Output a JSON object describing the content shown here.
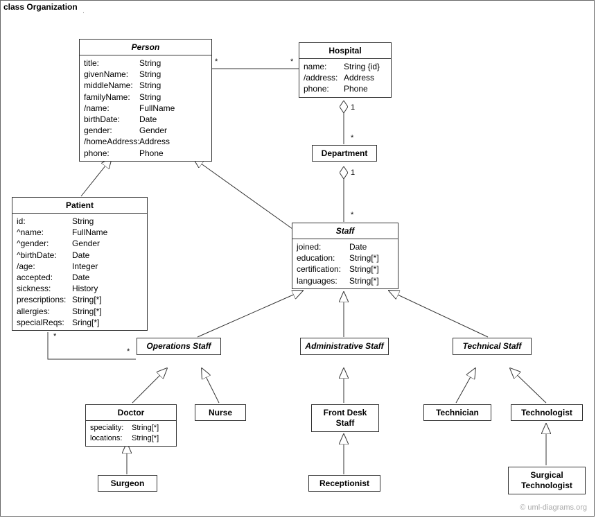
{
  "frame": {
    "title": "class Organization"
  },
  "watermark": "© uml-diagrams.org",
  "classes": {
    "person": {
      "title": "Person",
      "attrs": [
        {
          "name": "title:",
          "type": "String"
        },
        {
          "name": "givenName:",
          "type": "String"
        },
        {
          "name": "middleName:",
          "type": "String"
        },
        {
          "name": "familyName:",
          "type": "String"
        },
        {
          "name": "/name:",
          "type": "FullName"
        },
        {
          "name": "birthDate:",
          "type": "Date"
        },
        {
          "name": "gender:",
          "type": "Gender"
        },
        {
          "name": "/homeAddress:",
          "type": "Address"
        },
        {
          "name": "phone:",
          "type": "Phone"
        }
      ]
    },
    "hospital": {
      "title": "Hospital",
      "attrs": [
        {
          "name": "name:",
          "type": "String {id}"
        },
        {
          "name": "/address:",
          "type": "Address"
        },
        {
          "name": "phone:",
          "type": "Phone"
        }
      ]
    },
    "department": {
      "title": "Department"
    },
    "patient": {
      "title": "Patient",
      "attrs": [
        {
          "name": "id:",
          "type": "String"
        },
        {
          "name": "^name:",
          "type": "FullName"
        },
        {
          "name": "^gender:",
          "type": "Gender"
        },
        {
          "name": "^birthDate:",
          "type": "Date"
        },
        {
          "name": "/age:",
          "type": "Integer"
        },
        {
          "name": "accepted:",
          "type": "Date"
        },
        {
          "name": "sickness:",
          "type": "History"
        },
        {
          "name": "prescriptions:",
          "type": "String[*]"
        },
        {
          "name": "allergies:",
          "type": "String[*]"
        },
        {
          "name": "specialReqs:",
          "type": "Sring[*]"
        }
      ]
    },
    "staff": {
      "title": "Staff",
      "attrs": [
        {
          "name": "joined:",
          "type": "Date"
        },
        {
          "name": "education:",
          "type": "String[*]"
        },
        {
          "name": "certification:",
          "type": "String[*]"
        },
        {
          "name": "languages:",
          "type": "String[*]"
        }
      ]
    },
    "opsStaff": {
      "title": "Operations Staff"
    },
    "adminStaff": {
      "title": "Administrative Staff"
    },
    "techStaff": {
      "title": "Technical Staff"
    },
    "doctor": {
      "title": "Doctor",
      "attrs": [
        {
          "name": "speciality:",
          "type": "String[*]"
        },
        {
          "name": "locations:",
          "type": "String[*]"
        }
      ]
    },
    "nurse": {
      "title": "Nurse"
    },
    "frontDesk": {
      "title": "Front Desk Staff"
    },
    "technician": {
      "title": "Technician"
    },
    "technologist": {
      "title": "Technologist"
    },
    "surgeon": {
      "title": "Surgeon"
    },
    "receptionist": {
      "title": "Receptionist"
    },
    "surgTech": {
      "title": "Surgical Technologist"
    }
  },
  "mult": {
    "personHospL": "*",
    "personHospR": "*",
    "hospDeptTop": "1",
    "hospDeptBot": "*",
    "deptStaffTop": "1",
    "deptStaffBot": "*",
    "patientOpsL": "*",
    "patientOpsR": "*"
  }
}
